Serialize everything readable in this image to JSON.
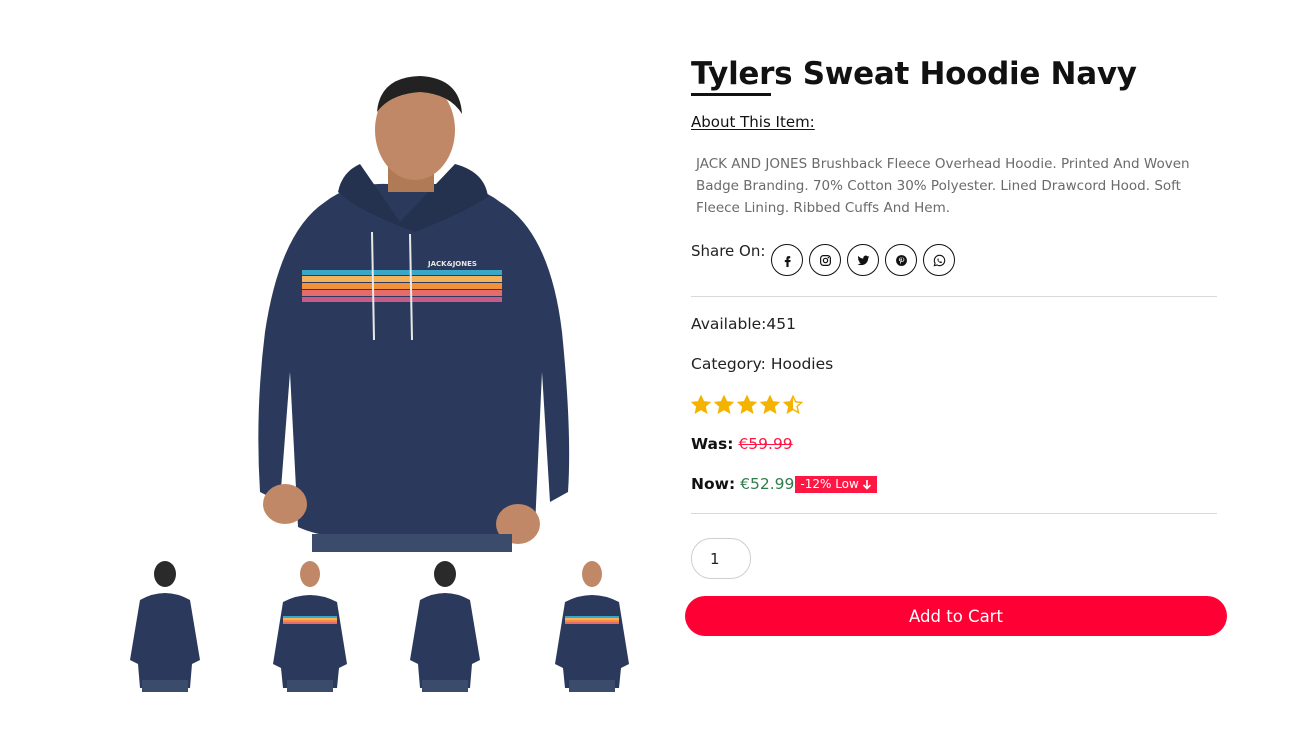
{
  "product": {
    "title": "Tylers Sweat Hoodie Navy",
    "about_label": "About This Item:",
    "description": "JACK AND JONES Brushback Fleece Overhead Hoodie. Printed And Woven Badge Branding. 70% Cotton 30% Polyester. Lined Drawcord Hood. Soft Fleece Lining. Ribbed Cuffs And Hem.",
    "share_label": "Share On:",
    "share_icons": [
      "facebook-icon",
      "instagram-icon",
      "twitter-icon",
      "pinterest-icon",
      "whatsapp-icon"
    ],
    "available": "Available:451",
    "category": "Category: Hoodies",
    "rating": 4.5,
    "rating_max": 5,
    "was_label": "Was:",
    "was_price": "€59.99",
    "now_label": "Now:",
    "now_price": "€52.99",
    "discount_badge": "-12% Low",
    "quantity": "1",
    "add_to_cart": "Add to Cart"
  },
  "gallery": {
    "thumbnails": [
      "hoodie-back-view",
      "hoodie-front-view",
      "hoodie-back-view",
      "hoodie-front-view"
    ]
  },
  "colors": {
    "accent": "#ff0035",
    "star": "#f5b301",
    "old_price": "#ff1744",
    "new_price": "#2e7d4a",
    "hoodie": "#2b3a5c"
  }
}
